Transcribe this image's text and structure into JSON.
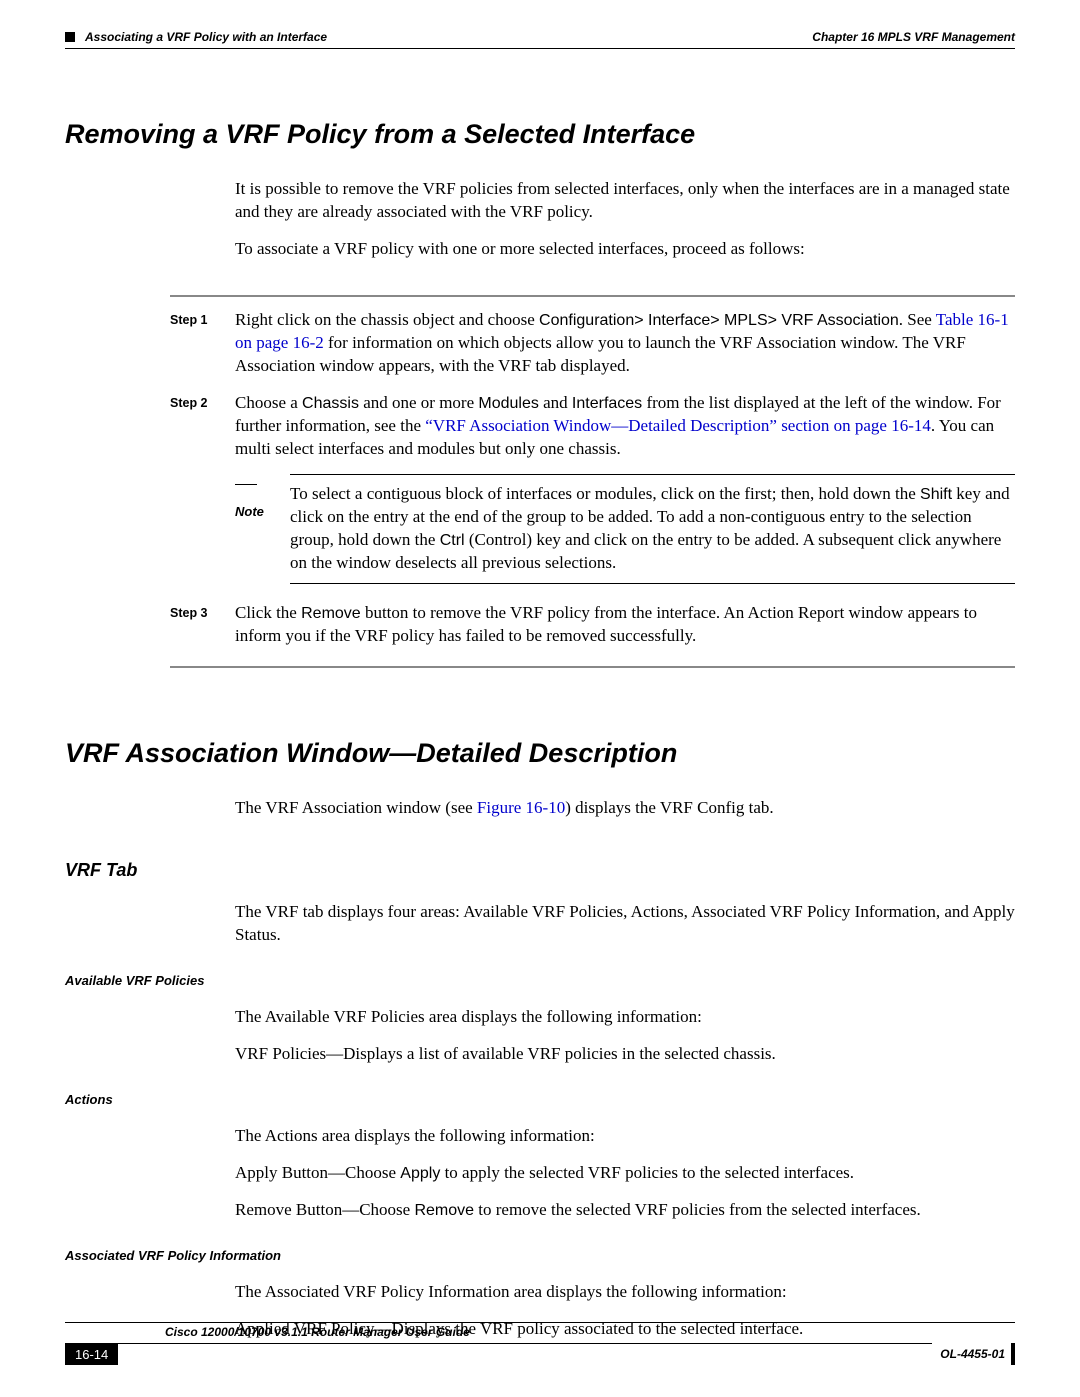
{
  "header": {
    "section": "Associating a VRF Policy with an Interface",
    "chapter": "Chapter 16      MPLS VRF Management"
  },
  "s1": {
    "title": "Removing a VRF Policy from a Selected Interface",
    "p1": "It is possible to remove the VRF policies from selected interfaces, only when the interfaces are in a managed state and they are already associated with the VRF policy.",
    "p2": "To associate a VRF policy with one or more selected interfaces, proceed as follows:",
    "steps": {
      "s1label": "Step 1",
      "s1a": "Right click on the chassis object and choose ",
      "s1b": "Configuration> Interface> MPLS> VRF Association",
      "s1c": ". See ",
      "s1link": "Table 16-1 on page 16-2",
      "s1d": " for information on which objects allow you to launch the VRF Association window. The VRF Association window appears, with the VRF tab displayed.",
      "s2label": "Step 2",
      "s2a": "Choose a ",
      "s2b": "Chassis",
      "s2c": " and one or more ",
      "s2d": "Modules",
      "s2e": " and ",
      "s2f": "Interfaces",
      "s2g": " from the list displayed at the left of the window. For further information, see the ",
      "s2link": "“VRF Association Window—Detailed Description” section on page 16-14",
      "s2h": ". You can multi select interfaces and modules but only one chassis.",
      "notelabel": "Note",
      "n1a": "To select a contiguous block of interfaces or modules, click on the first; then, hold down the ",
      "n1b": "Shift",
      "n1c": " key and click on the entry at the end of the group to be added. To add a non-contiguous entry to the selection group, hold down the ",
      "n1d": "Ctrl",
      "n1e": " (Control) key and click on the entry to be added. A subsequent click anywhere on the window deselects all previous selections.",
      "s3label": "Step 3",
      "s3a": "Click the ",
      "s3b": "Remove",
      "s3c": " button to remove the VRF policy from the interface. An Action Report window appears to inform you if the VRF policy has failed to be removed successfully."
    }
  },
  "s2": {
    "title": "VRF Association Window—Detailed Description",
    "p1a": "The VRF Association window (see ",
    "p1link": "Figure 16-10",
    "p1b": ") displays the VRF Config tab.",
    "h3": "VRF Tab",
    "p2": "The VRF tab displays four areas: Available VRF Policies, Actions, Associated VRF Policy Information, and Apply Status.",
    "h4a": "Available VRF Policies",
    "p3": "The Available VRF Policies area displays the following information:",
    "p4": "VRF Policies—Displays a list of available VRF policies in the selected chassis.",
    "h4b": "Actions",
    "p5": "The Actions area displays the following information:",
    "p6a": "Apply Button—Choose ",
    "p6b": "Apply",
    "p6c": " to apply the selected VRF policies to the selected interfaces.",
    "p7a": "Remove Button—Choose ",
    "p7b": "Remove",
    "p7c": " to remove the selected VRF policies from the selected interfaces.",
    "h4c": "Associated VRF Policy Information",
    "p8": "The Associated VRF Policy Information area displays the following information:",
    "p9": "Applied VRF Policy—Displays the VRF policy associated to the selected interface."
  },
  "footer": {
    "book": "Cisco 12000/10700 v3.1.1 Router Manager User Guide",
    "page": "16-14",
    "docid": "OL-4455-01"
  }
}
